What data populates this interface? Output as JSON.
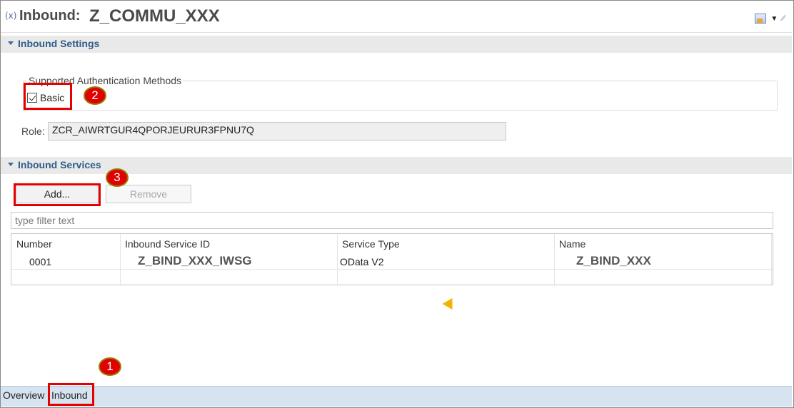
{
  "header": {
    "icon_text": "(x)",
    "title": "Inbound:",
    "name": "Z_COMMU_XXX",
    "tools": [
      "display-options-icon",
      "dropdown-icon",
      "minimize-icon"
    ]
  },
  "inbound_settings": {
    "section_title": "Inbound Settings",
    "auth_group_label": "Supported Authentication Methods",
    "basic_label": "Basic",
    "basic_checked": true,
    "role_label": "Role:",
    "role_value": "ZCR_AIWRTGUR4QPORJEURUR3FPNU7Q"
  },
  "inbound_services": {
    "section_title": "Inbound Services",
    "add_label": "Add...",
    "remove_label": "Remove",
    "filter_placeholder": "type filter text",
    "columns": [
      "Number",
      "Inbound Service ID",
      "Service Type",
      "Name"
    ],
    "rows": [
      {
        "number": "0001",
        "service_id": "Z_BIND_XXX_IWSG",
        "service_type": "OData V2",
        "name": "Z_BIND_XXX"
      }
    ]
  },
  "tabs": [
    "Overview",
    "Inbound"
  ],
  "active_tab": "Inbound",
  "annotations": {
    "step1": "1",
    "step2": "2",
    "step3": "3",
    "highlight_color": "#e60000"
  }
}
